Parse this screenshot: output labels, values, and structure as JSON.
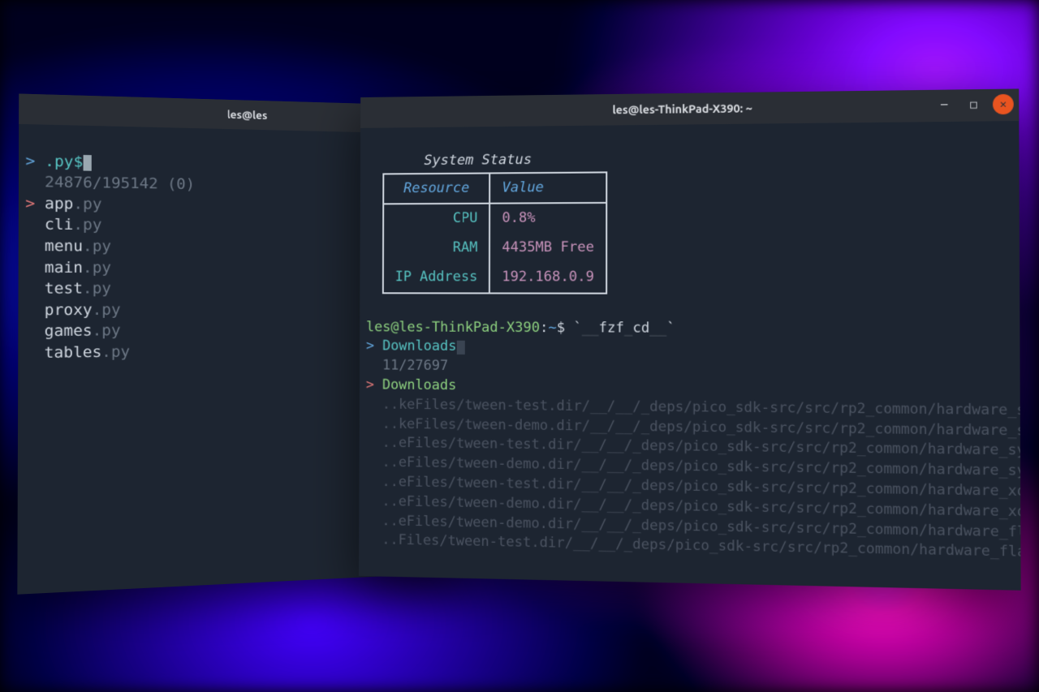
{
  "windows": {
    "left": {
      "title": "les@les",
      "fzf_left": {
        "query": ".py$",
        "count": "24876/195142 (0)",
        "selected": "app",
        "selected_ext": ".py",
        "rest": [
          {
            "name": "cli",
            "ext": ".py"
          },
          {
            "name": "menu",
            "ext": ".py"
          },
          {
            "name": "main",
            "ext": ".py"
          },
          {
            "name": "test",
            "ext": ".py"
          },
          {
            "name": "proxy",
            "ext": ".py"
          },
          {
            "name": "games",
            "ext": ".py"
          },
          {
            "name": "tables",
            "ext": ".py"
          }
        ]
      }
    },
    "right": {
      "title": "les@les-ThinkPad-X390: ~",
      "system_status": {
        "heading": "System Status",
        "cols": {
          "c1": "Resource",
          "c2": "Value"
        },
        "rows": {
          "cpu": {
            "label": "CPU",
            "value": "0.8%"
          },
          "ram": {
            "label": "RAM",
            "value": "4435MB Free"
          },
          "ip": {
            "label": "IP Address",
            "value": "192.168.0.9"
          }
        }
      },
      "prompt": {
        "user_host": "les@les-ThinkPad-X390",
        "path": "~",
        "sep": ":",
        "dollar": "$",
        "command": "`__fzf_cd__`"
      },
      "fzf_right": {
        "query": "Downloads",
        "count": "11/27697",
        "selected": "Downloads",
        "rest": [
          "..keFiles/tween-test.dir/__/__/_deps/pico_sdk-src/src/rp2_common/hardware_spi",
          "..keFiles/tween-demo.dir/__/__/_deps/pico_sdk-src/src/rp2_common/hardware_spi",
          "..eFiles/tween-test.dir/__/__/_deps/pico_sdk-src/src/rp2_common/hardware_sync",
          "..eFiles/tween-demo.dir/__/__/_deps/pico_sdk-src/src/rp2_common/hardware_sync",
          "..eFiles/tween-test.dir/__/__/_deps/pico_sdk-src/src/rp2_common/hardware_xosc",
          "..eFiles/tween-demo.dir/__/__/_deps/pico_sdk-src/src/rp2_common/hardware_xosc",
          "..eFiles/tween-demo.dir/__/__/_deps/pico_sdk-src/src/rp2_common/hardware_flash",
          "..Files/tween-test.dir/__/__/_deps/pico_sdk-src/src/rp2_common/hardware_flash"
        ]
      }
    }
  },
  "glyph": {
    "chevron": ">",
    "minimize": "─",
    "maximize": "□",
    "close": "✕"
  }
}
